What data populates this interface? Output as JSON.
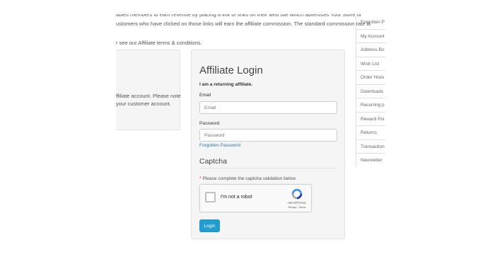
{
  "intro": {
    "line1": "ables members to earn revenue by placing a link or links on their web site which advertises Your Store or",
    "line2": "ustomers who have clicked on those links will earn the affiliate commission. The standard commission rate is",
    "line3": "r see our Affiliate terms & conditions."
  },
  "register_panel": {
    "text_line1": "ffiliate account. Please note",
    "text_line2": "your customer account."
  },
  "login": {
    "title": "Affiliate Login",
    "returning": "I am a returning affiliate.",
    "email_label": "Email",
    "email_placeholder": "Email",
    "password_label": "Password",
    "password_placeholder": "Password",
    "forgotten_link": "Forgotten Password",
    "captcha_title": "Captcha",
    "captcha_note": "Please complete the captcha validation below",
    "recaptcha": {
      "label": "I'm not a robot",
      "brand": "reCAPTCHA",
      "terms": "Privacy - Terms"
    },
    "login_button": "Login"
  },
  "sidebar": {
    "items": [
      {
        "label": "Forgotten P"
      },
      {
        "label": "My Account"
      },
      {
        "label": "Address Bo"
      },
      {
        "label": "Wish List"
      },
      {
        "label": "Order Histo"
      },
      {
        "label": "Downloads"
      },
      {
        "label": "Recurring p"
      },
      {
        "label": "Reward Poi"
      },
      {
        "label": "Returns"
      },
      {
        "label": "Transaction"
      },
      {
        "label": "Newsletter"
      }
    ]
  },
  "colors": {
    "accent": "#239cd2",
    "link": "#2a7ab0",
    "required": "#ff0000",
    "well": "#f5f5f5"
  }
}
